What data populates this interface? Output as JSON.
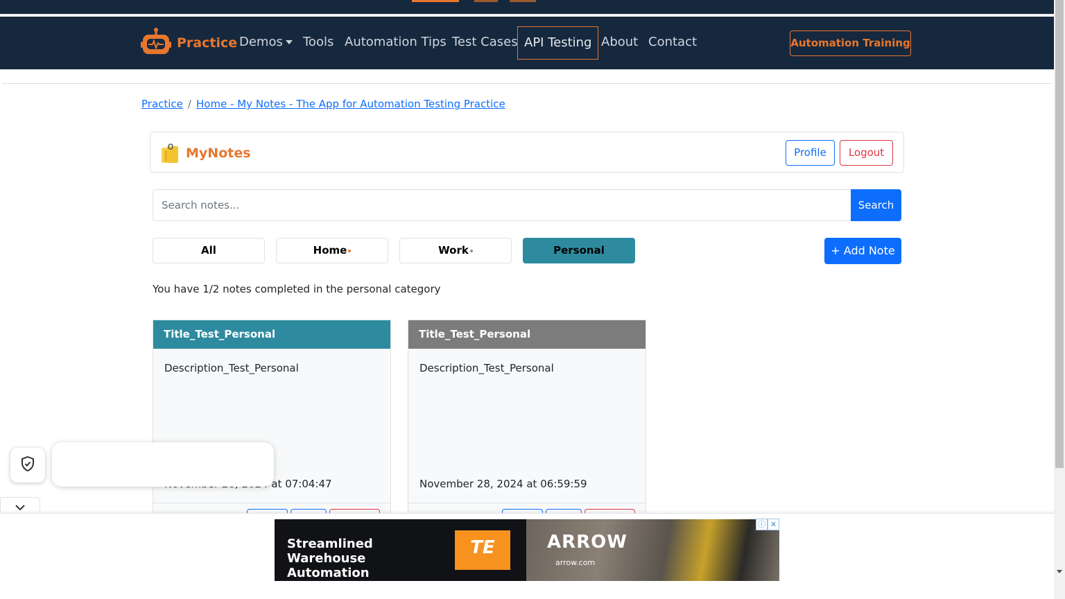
{
  "navbar": {
    "brand": "Practice",
    "items": [
      {
        "label": "Demos"
      },
      {
        "label": "Tools"
      },
      {
        "label": "Automation Tips"
      },
      {
        "label": "Test Cases"
      },
      {
        "label": "API Testing"
      },
      {
        "label": "About"
      },
      {
        "label": "Contact"
      }
    ],
    "cta": "Automation Training"
  },
  "breadcrumb": {
    "root": "Practice",
    "separator": "/",
    "current": "Home - My Notes - The App for Automation Testing Practice"
  },
  "app": {
    "title": "MyNotes",
    "profile_label": "Profile",
    "logout_label": "Logout"
  },
  "search": {
    "placeholder": "Search notes...",
    "button_label": "Search"
  },
  "categories": [
    {
      "label": "All",
      "active": false
    },
    {
      "label": "Home",
      "active": false
    },
    {
      "label": "Work",
      "active": false
    },
    {
      "label": "Personal",
      "active": true
    }
  ],
  "add_note_label": "+ Add Note",
  "progress_text": "You have 1/2 notes completed in the personal category",
  "notes": [
    {
      "title": "Title_Test_Personal",
      "description": "Description_Test_Personal",
      "date": "November 28, 2024 at 07:04:47",
      "header_color": "#2e8b9f"
    },
    {
      "title": "Title_Test_Personal",
      "description": "Description_Test_Personal",
      "date": "November 28, 2024 at 06:59:59",
      "header_color": "#7b7c7b"
    }
  ],
  "ad": {
    "headline": "Streamlined Warehouse Automation",
    "te_logo": "TE",
    "brand": "ARROW",
    "url": "arrow.com"
  },
  "colors": {
    "navbar": "#16283e",
    "accent": "#e8772e",
    "primary": "#0d6efd",
    "danger": "#dc3545",
    "personal": "#2e8b9f"
  }
}
